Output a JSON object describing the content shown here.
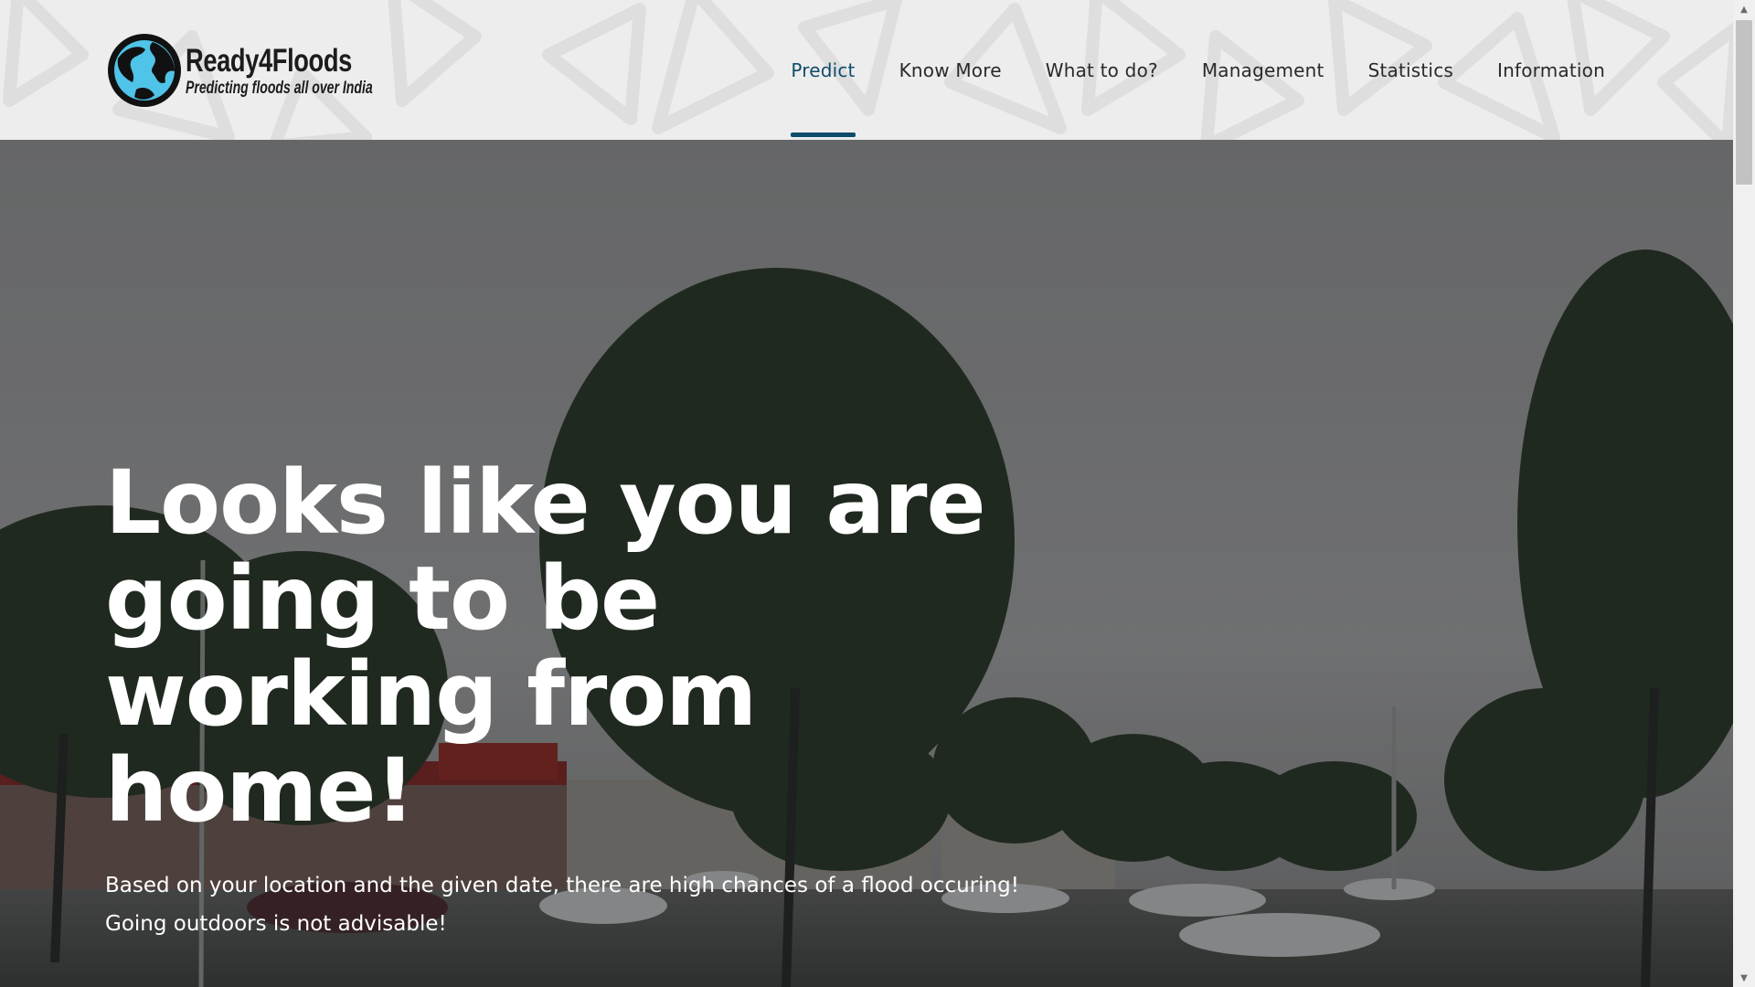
{
  "brand": {
    "name": "Ready4Floods",
    "tagline": "Predicting floods all over India",
    "globe_color": "#4fc3e8"
  },
  "nav": {
    "items": [
      {
        "label": "Predict",
        "active": true
      },
      {
        "label": "Know More",
        "active": false
      },
      {
        "label": "What to do?",
        "active": false
      },
      {
        "label": "Management",
        "active": false
      },
      {
        "label": "Statistics",
        "active": false
      },
      {
        "label": "Information",
        "active": false
      }
    ],
    "active_color": "#0f4c6b"
  },
  "hero": {
    "title": "Looks like you are going to be working from home!",
    "subtitle_line1": "Based on your location and the given date, there are high chances of a flood occuring!",
    "subtitle_line2": "Going outdoors is not advisable!",
    "background": "flooded-parking-lot-photo"
  }
}
